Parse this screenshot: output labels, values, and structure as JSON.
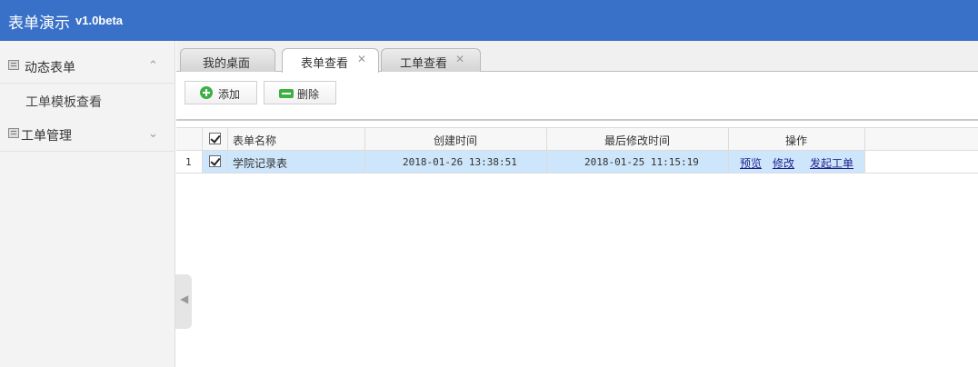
{
  "header": {
    "title": "表单演示",
    "version": "v1.0beta"
  },
  "sidebar": {
    "groups": [
      {
        "label": "动态表单",
        "expanded": true,
        "items": [
          {
            "label": "工单模板查看"
          }
        ]
      },
      {
        "label": "工单管理",
        "expanded": false,
        "items": []
      }
    ]
  },
  "tabs": [
    {
      "label": "我的桌面",
      "closable": false,
      "active": false
    },
    {
      "label": "表单查看",
      "closable": true,
      "active": true
    },
    {
      "label": "工单查看",
      "closable": true,
      "active": false
    }
  ],
  "toolbar": {
    "add_label": "添加",
    "delete_label": "删除"
  },
  "grid": {
    "columns": [
      "表单名称",
      "创建时间",
      "最后修改时间",
      "操作"
    ],
    "rows": [
      {
        "index": "1",
        "checked": true,
        "name": "学院记录表",
        "created": "2018-01-26 13:38:51",
        "modified": "2018-01-25 11:15:19",
        "actions": [
          "预览",
          "修改",
          "发起工单"
        ]
      }
    ]
  },
  "colors": {
    "header_bg": "#3a71c8",
    "selected_row": "#cde6fb",
    "add_icon": "#3cb043",
    "link": "#1e1e8c"
  }
}
